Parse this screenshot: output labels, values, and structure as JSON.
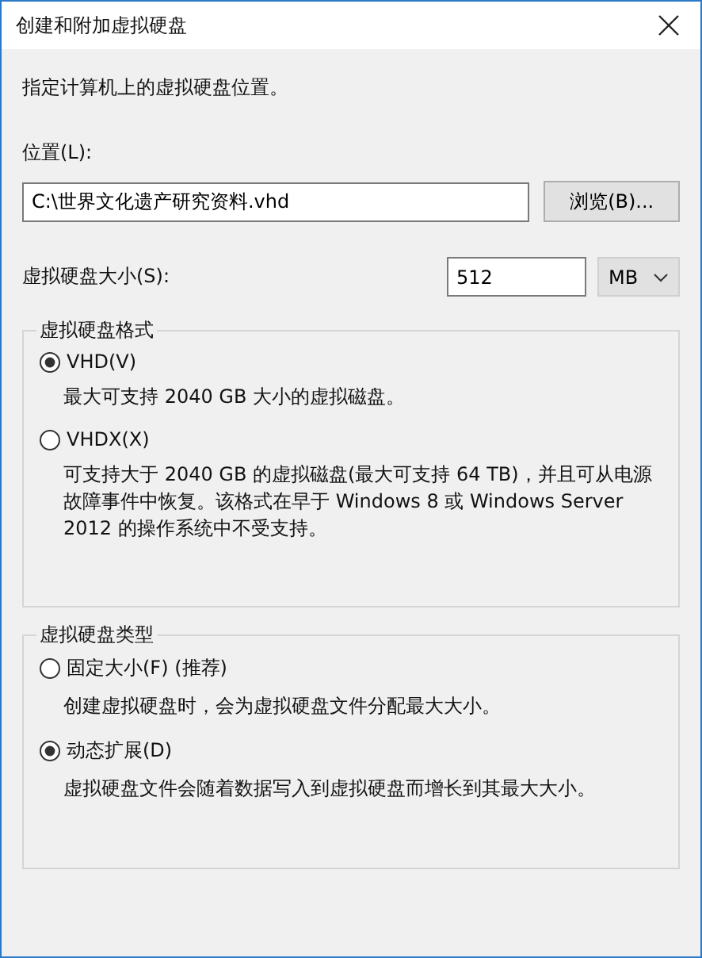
{
  "window": {
    "title": "创建和附加虚拟硬盘"
  },
  "intro": "指定计算机上的虚拟硬盘位置。",
  "location": {
    "label": "位置(L):",
    "value": "C:\\世界文化遗产研究资料.vhd",
    "browse_button": "浏览(B)..."
  },
  "size": {
    "label": "虚拟硬盘大小(S):",
    "value": "512",
    "unit": "MB"
  },
  "groups": [
    {
      "title": "虚拟硬盘格式",
      "options": [
        {
          "label": "VHD(V)",
          "selected": true,
          "description": "最大可支持 2040 GB 大小的虚拟磁盘。"
        },
        {
          "label": "VHDX(X)",
          "selected": false,
          "description": "可支持大于 2040 GB 的虚拟磁盘(最大可支持 64 TB)，并且可从电源故障事件中恢复。该格式在早于 Windows 8 或 Windows Server 2012 的操作系统中不受支持。"
        }
      ]
    },
    {
      "title": "虚拟硬盘类型",
      "options": [
        {
          "label": "固定大小(F) (推荐)",
          "selected": false,
          "description": "创建虚拟硬盘时，会为虚拟硬盘文件分配最大大小。"
        },
        {
          "label": "动态扩展(D)",
          "selected": true,
          "description": "虚拟硬盘文件会随着数据写入到虚拟硬盘而增长到其最大大小。"
        }
      ]
    }
  ]
}
